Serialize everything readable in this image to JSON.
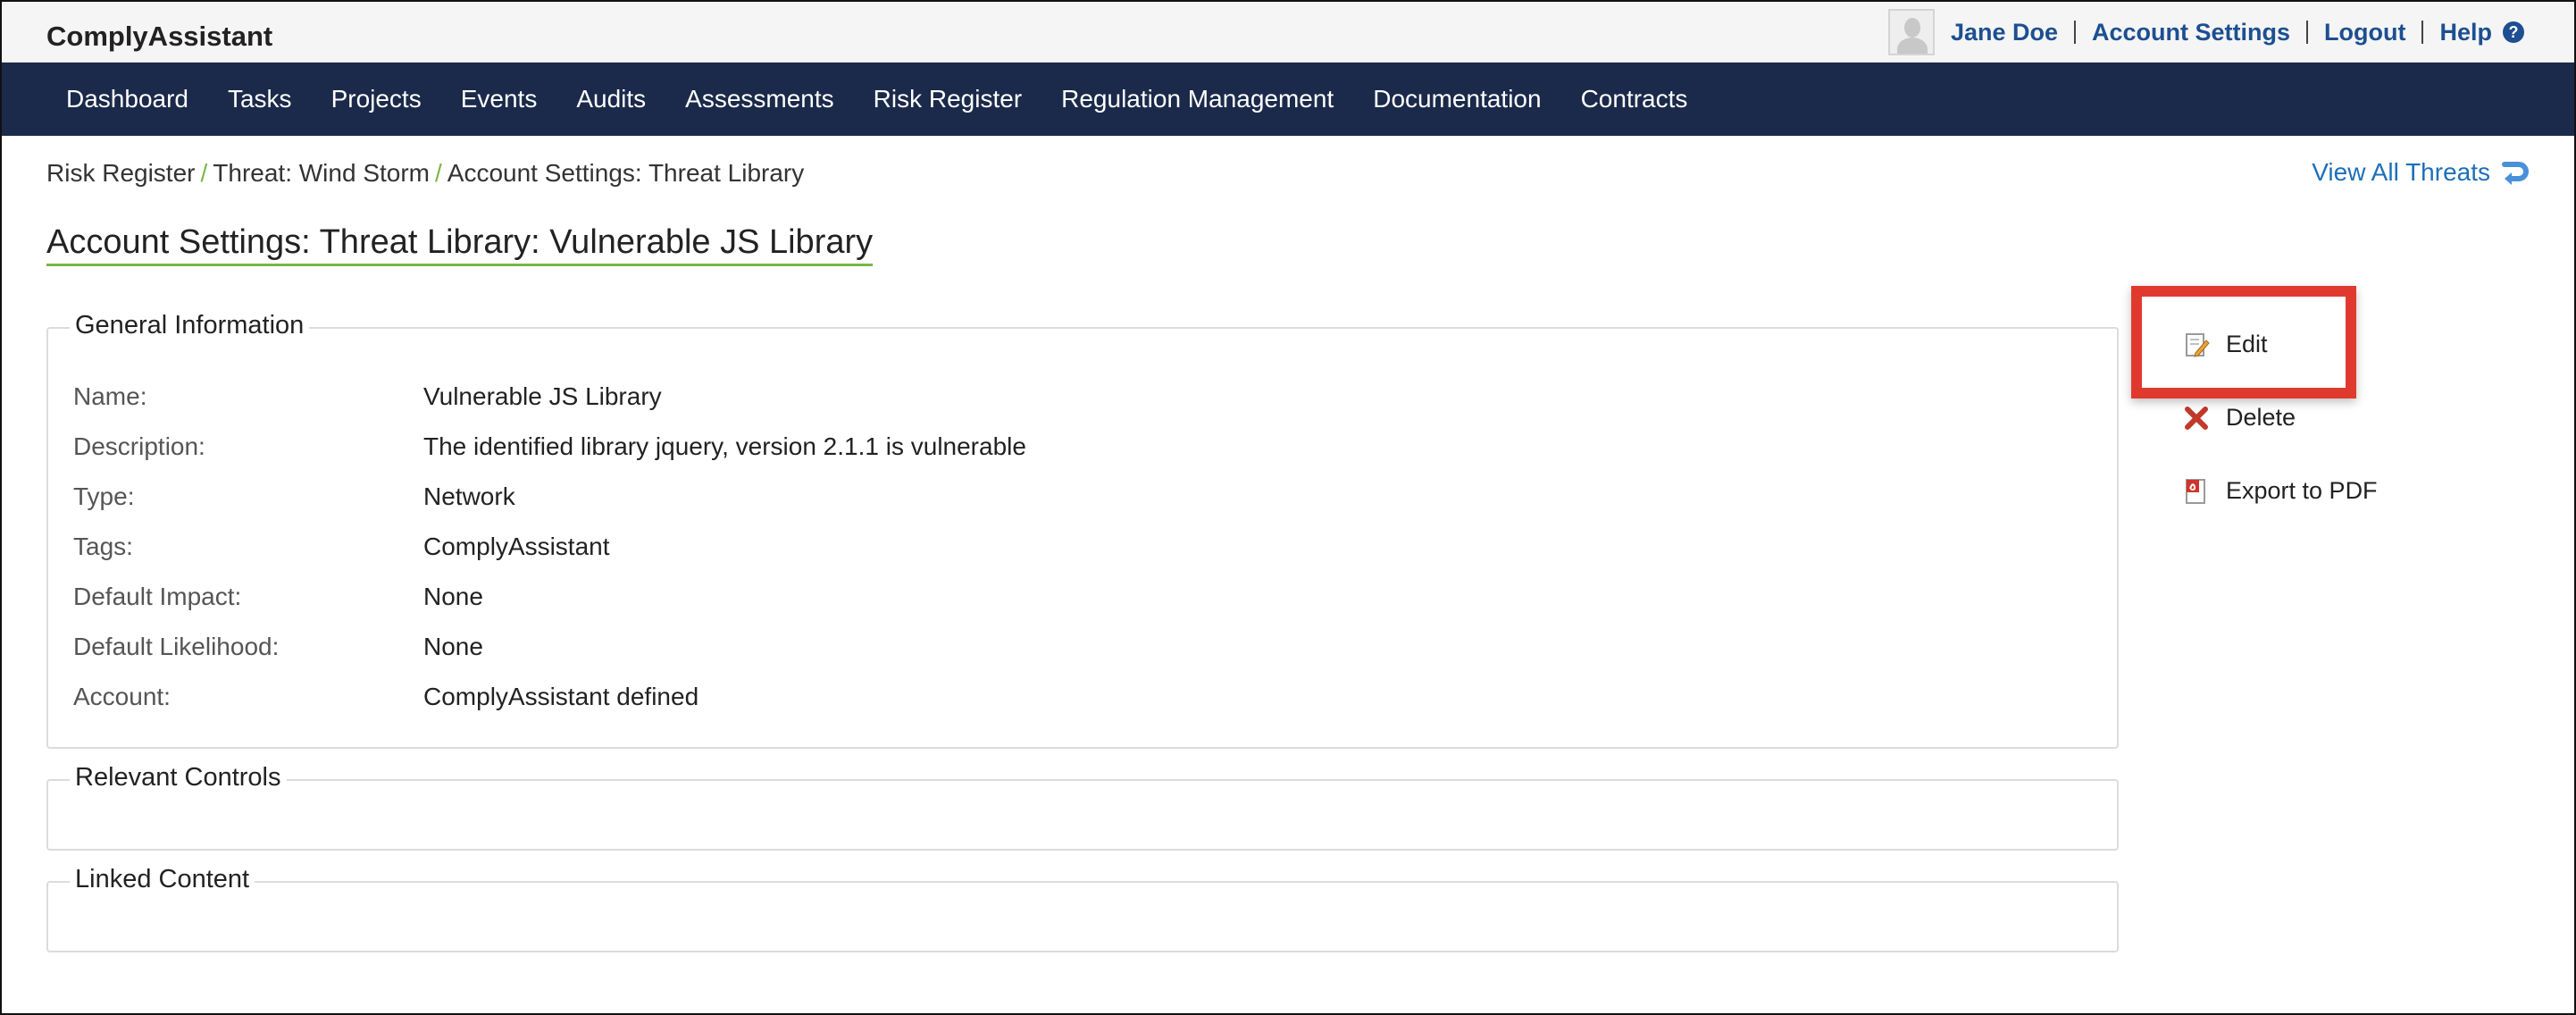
{
  "app": {
    "brand": "ComplyAssistant"
  },
  "user_nav": {
    "user_name": "Jane Doe",
    "account_settings": "Account Settings",
    "logout": "Logout",
    "help": "Help"
  },
  "main_nav": {
    "items": [
      {
        "label": "Dashboard"
      },
      {
        "label": "Tasks"
      },
      {
        "label": "Projects"
      },
      {
        "label": "Events"
      },
      {
        "label": "Audits"
      },
      {
        "label": "Assessments"
      },
      {
        "label": "Risk Register"
      },
      {
        "label": "Regulation Management"
      },
      {
        "label": "Documentation"
      },
      {
        "label": "Contracts"
      }
    ]
  },
  "breadcrumb": {
    "items": [
      {
        "label": "Risk Register"
      },
      {
        "label": "Threat: Wind Storm"
      },
      {
        "label": "Account Settings: Threat Library"
      }
    ],
    "separator": "/"
  },
  "view_all": {
    "label": "View All Threats"
  },
  "page": {
    "title": "Account Settings: Threat Library: Vulnerable JS Library"
  },
  "general_info": {
    "legend": "General Information",
    "rows": [
      {
        "label": "Name:",
        "value": "Vulnerable JS Library"
      },
      {
        "label": "Description:",
        "value": "The identified library jquery, version 2.1.1 is vulnerable"
      },
      {
        "label": "Type:",
        "value": "Network"
      },
      {
        "label": "Tags:",
        "value": "ComplyAssistant"
      },
      {
        "label": "Default Impact:",
        "value": "None"
      },
      {
        "label": "Default Likelihood:",
        "value": "None"
      },
      {
        "label": "Account:",
        "value": "ComplyAssistant defined"
      }
    ]
  },
  "relevant_controls": {
    "legend": "Relevant Controls"
  },
  "linked_content": {
    "legend": "Linked Content"
  },
  "actions": {
    "edit": "Edit",
    "delete": "Delete",
    "export_pdf": "Export to PDF"
  },
  "colors": {
    "nav_bg": "#1b2a4a",
    "link": "#1d4f91",
    "accent_green": "#7ab648",
    "highlight_red": "#e03a2f"
  }
}
